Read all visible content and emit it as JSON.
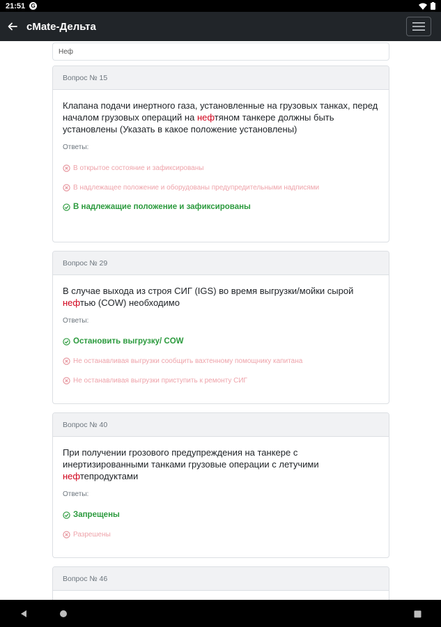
{
  "status_bar": {
    "time": "21:51",
    "app_icon": "G"
  },
  "app_bar": {
    "title": "cMate-Дельта"
  },
  "search": {
    "value": "Неф",
    "placeholder": ""
  },
  "answers_label": "Ответы:",
  "questions": [
    {
      "header": "Вопрос № 15",
      "text_before": "Клапана подачи инертного газа, установленные на грузовых танках, перед началом грузовых операций на ",
      "highlight": "неф",
      "text_after": "тяном танкере должны быть установлены (Указать в какое положение установлены)",
      "answers": [
        {
          "text": "В открытое состояние и зафиксированы",
          "correct": false
        },
        {
          "text": "В надлежащее положение и оборудованы предупредительными надписями",
          "correct": false
        },
        {
          "text": "В надлежащие положение и зафиксированы",
          "correct": true
        }
      ]
    },
    {
      "header": "Вопрос № 29",
      "text_before": "В случае выхода из строя СИГ (IGS) во время выгрузки/мойки сырой ",
      "highlight": "неф",
      "text_after": "тью (COW) необходимо",
      "answers": [
        {
          "text": "Остановить выгрузку/ COW",
          "correct": true
        },
        {
          "text": "Не останавливая выгрузки сообщить вахтенному помощнику капитана",
          "correct": false
        },
        {
          "text": "Не останавливая выгрузки приступить к ремонту СИГ",
          "correct": false
        }
      ]
    },
    {
      "header": "Вопрос № 40",
      "text_before": "При получении грозового предупреждения на танкере с инертизированными танками грузовые операции с летучими ",
      "highlight": "неф",
      "text_after": "тепродуктами",
      "answers": [
        {
          "text": "Запрещены",
          "correct": true
        },
        {
          "text": "Разрешены",
          "correct": false
        }
      ]
    },
    {
      "header": "Вопрос № 46"
    }
  ],
  "icons": {
    "back": "arrow-left-icon",
    "menu": "hamburger-menu-icon",
    "wrong": "x-circle-icon",
    "right": "check-circle-icon",
    "nav_back": "triangle-back-icon",
    "nav_home": "circle-home-icon",
    "nav_recent": "square-recents-icon"
  },
  "colors": {
    "appbar": "#212529",
    "correct": "#2b9a3d",
    "wrong": "#eea3aa",
    "highlight": "#d0021b"
  }
}
